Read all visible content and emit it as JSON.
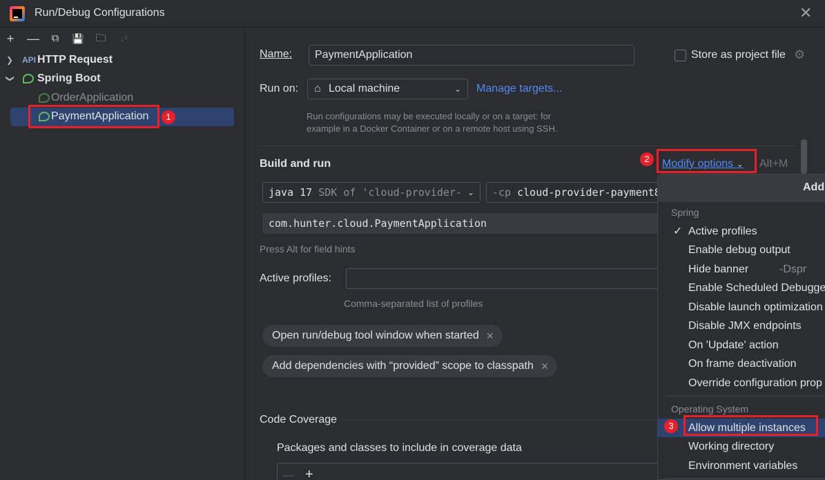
{
  "window": {
    "title": "Run/Debug Configurations"
  },
  "toolbar": {
    "add": "+",
    "remove": "—",
    "copy": "⧉",
    "save": "💾",
    "folder": "🗀",
    "sort": "↓²"
  },
  "tree": {
    "http_request": "HTTP Request",
    "spring_boot": "Spring Boot",
    "order_app": "OrderApplication",
    "payment_app": "PaymentApplication"
  },
  "annotations": {
    "badge1": "1",
    "badge2": "2",
    "badge3": "3"
  },
  "form": {
    "name_label": "Name:",
    "name_value": "PaymentApplication",
    "store_label": "Store as project file",
    "run_on_label": "Run on:",
    "run_on_value": "Local machine",
    "manage_targets": "Manage targets...",
    "run_on_hint_1": "Run configurations may be executed locally or on a target: for",
    "run_on_hint_2": "example in a Docker Container or on a remote host using SSH.",
    "build_and_run": "Build and run",
    "modify_options": "Modify options",
    "modify_shortcut": "Alt+M",
    "sdk_bold": "java 17",
    "sdk_rest": " SDK of 'cloud-provider-",
    "cp_flag": "-cp ",
    "cp_value": "cloud-provider-payment8",
    "main_class": "com.hunter.cloud.PaymentApplication",
    "field_hint": "Press Alt for field hints",
    "active_profiles_label": "Active profiles:",
    "active_profiles_hint": "Comma-separated list of profiles",
    "chip1": "Open run/debug tool window when started",
    "chip2": "Add dependencies with “provided” scope to classpath",
    "code_coverage": "Code Coverage",
    "packages_label": "Packages and classes to include in coverage data"
  },
  "menu": {
    "header": "Add",
    "spring_section": "Spring",
    "spring_items": [
      {
        "label": "Active profiles",
        "checked": true
      },
      {
        "label": "Enable debug output"
      },
      {
        "label": "Hide banner",
        "extra": "-Dspr"
      },
      {
        "label": "Enable Scheduled Debugge"
      },
      {
        "label": "Disable launch optimization"
      },
      {
        "label": "Disable JMX endpoints"
      },
      {
        "label": "On 'Update' action"
      },
      {
        "label": "On frame deactivation"
      },
      {
        "label": "Override configuration prop"
      }
    ],
    "os_section": "Operating System",
    "os_items": [
      {
        "label": "Allow multiple instances",
        "highlighted": true
      },
      {
        "label": "Working directory"
      },
      {
        "label": "Environment variables"
      }
    ]
  },
  "colors": {
    "accent": "#548af7",
    "selection": "#2e436e",
    "annotation": "#e8202a"
  }
}
